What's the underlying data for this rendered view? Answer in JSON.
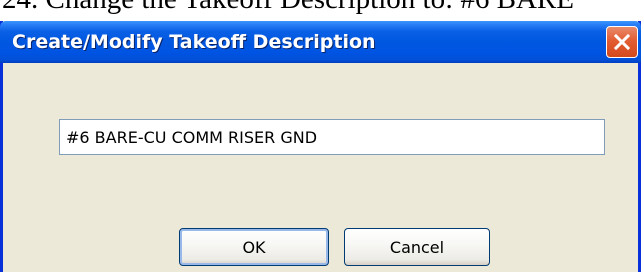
{
  "document": {
    "instruction_text": "24. Change the Takeoff Description to: #6 BARE"
  },
  "dialog": {
    "title": "Create/Modify Takeoff Description",
    "description_value": "#6 BARE-CU COMM RISER GND",
    "ok_label": "OK",
    "cancel_label": "Cancel",
    "close_icon": "close-icon"
  },
  "colors": {
    "titlebar": "#0054e3",
    "window_face": "#ece9d8",
    "close_button": "#e35d33",
    "input_border": "#7f9db9"
  }
}
